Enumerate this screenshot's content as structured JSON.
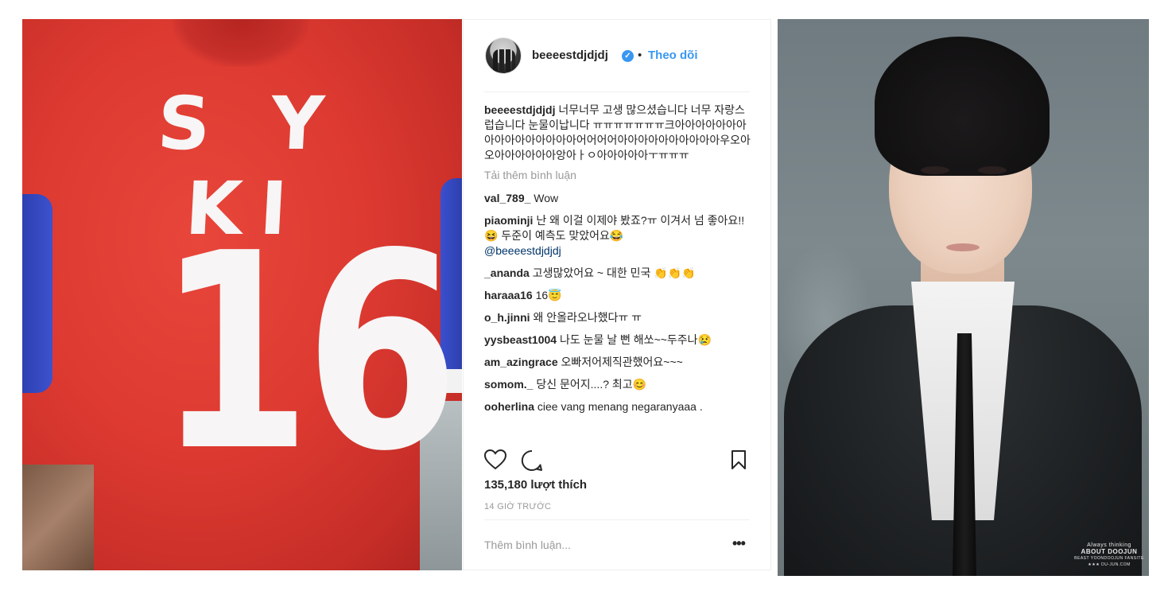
{
  "left_photo": {
    "jersey_name": "S Y KI",
    "jersey_number": "16"
  },
  "post": {
    "username": "beeeestdjdjdj",
    "verified_mark": "✓",
    "separator": "•",
    "follow_label": "Theo dõi",
    "caption_user": "beeeestdjdjdj",
    "caption_text": "너무너무 고생 많으셨습니다 너무 자랑스럽습니다 눈물이납니다 ㅠㅠㅠㅠㅠㅠㅠ크아아아아아아아아아아아아아아아아어어어어아아아아아아아아아아우오아오아아아아아아앙아ㅏㅇ아아아아아ㅜㅠㅠㅠ",
    "load_more_label": "Tải thêm bình luận",
    "comments": [
      {
        "user": "val_789_",
        "text": "Wow"
      },
      {
        "user": "piaominji",
        "text": "난 왜 이걸 이제야 봤죠?ㅠ 이겨서 넘 좋아요!!😆 두준이 예측도 맞았어요😂",
        "mention": "@beeeestdjdjdj"
      },
      {
        "user": "_ananda",
        "text": "고생많았어요 ~ 대한 민국 👏👏👏"
      },
      {
        "user": "haraaa16",
        "text": "16😇"
      },
      {
        "user": "o_h.jinni",
        "text": "왜 안올라오나했다ㅠ ㅠ"
      },
      {
        "user": "yysbeast1004",
        "text": "나도 눈물 날 뻔 해쏘~~두주나😢"
      },
      {
        "user": "am_azingrace",
        "text": "오빠저어제직관했어요~~~"
      },
      {
        "user": "somom._",
        "text": "당신 문어지....? 최고😊"
      },
      {
        "user": "ooherlina",
        "text": "ciee vang menang negaranyaaa ."
      }
    ],
    "likes": "135,180 lượt thích",
    "time": "14 GIỜ TRƯỚC",
    "comment_placeholder": "Thêm bình luận...",
    "more_button": "•••"
  },
  "right_photo": {
    "watermark_line1": "Always thinking",
    "watermark_line2": "ABOUT DOOJUN",
    "watermark_line3": "BEAST YOONDOOJUN FANSITE",
    "watermark_line4": "★★★ DU-JUN.COM"
  },
  "colors": {
    "jersey_red": "#dd3a31",
    "jersey_blue": "#3d52cf",
    "link_blue": "#3897f0",
    "text_dark": "#262626",
    "text_muted": "#999999"
  }
}
